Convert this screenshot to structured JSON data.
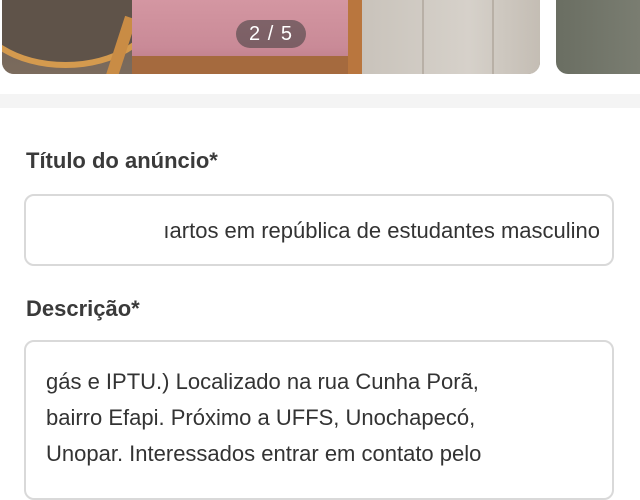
{
  "gallery": {
    "counter": "2 / 5"
  },
  "form": {
    "title_label": "Título do anúncio*",
    "title_value": "ıartos em república de estudantes masculino",
    "description_label": "Descrição*",
    "description_lines": [
      "gás e IPTU.) Localizado na rua  Cunha Porã,",
      "bairro Efapi. Próximo a UFFS, Unochapecó,",
      "Unopar. Interessados entrar em contato pelo"
    ]
  }
}
